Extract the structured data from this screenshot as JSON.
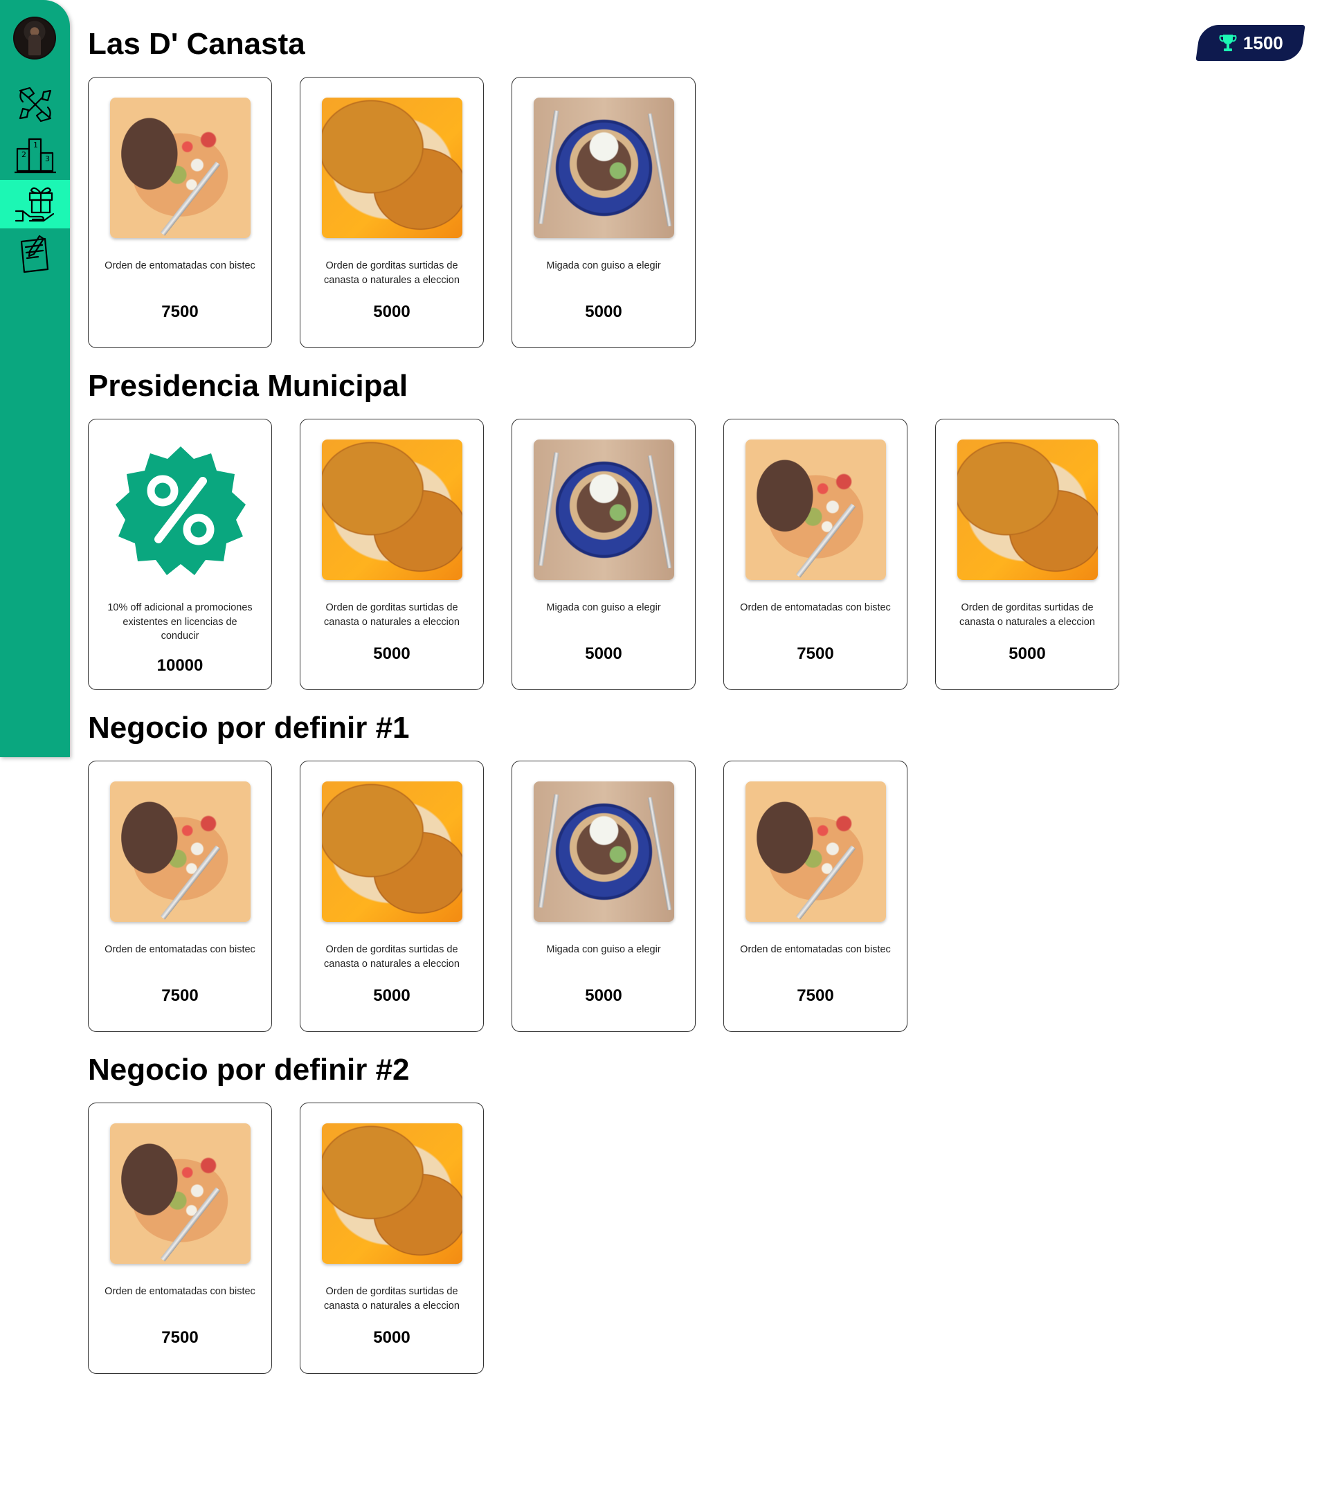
{
  "sidebar": {
    "items": [
      {
        "name": "community",
        "icon": "hands-group-icon",
        "active": false
      },
      {
        "name": "ranking",
        "icon": "podium-icon",
        "active": false
      },
      {
        "name": "rewards",
        "icon": "gift-hand-icon",
        "active": true
      },
      {
        "name": "tasks",
        "icon": "notepad-pencil-icon",
        "active": false
      }
    ]
  },
  "header": {
    "points": "1500",
    "points_icon": "trophy-icon"
  },
  "colors": {
    "sidebar": "#0aa77f",
    "sidebar_active": "#1cf7b4",
    "points_badge": "#0e1a4e",
    "trophy": "#1cf7b4"
  },
  "sections": [
    {
      "title": "Las D' Canasta",
      "items": [
        {
          "image": "entomatadas",
          "desc": "Orden de entomatadas con bistec",
          "price": "7500"
        },
        {
          "image": "gorditas",
          "desc": "Orden de gorditas surtidas de canasta o naturales a eleccion",
          "price": "5000"
        },
        {
          "image": "migada",
          "desc": "Migada con guiso a elegir",
          "price": "5000"
        }
      ]
    },
    {
      "title": "Presidencia Municipal",
      "items": [
        {
          "image": "discount-badge",
          "desc": "10% off adicional a promociones existentes en licencias de conducir",
          "price": "10000"
        },
        {
          "image": "gorditas",
          "desc": "Orden de gorditas surtidas de canasta o naturales a eleccion",
          "price": "5000"
        },
        {
          "image": "migada",
          "desc": "Migada con guiso a elegir",
          "price": "5000"
        },
        {
          "image": "entomatadas",
          "desc": "Orden de entomatadas con bistec",
          "price": "7500"
        },
        {
          "image": "gorditas",
          "desc": "Orden de gorditas surtidas de canasta o naturales a eleccion",
          "price": "5000"
        }
      ]
    },
    {
      "title": "Negocio por definir #1",
      "items": [
        {
          "image": "entomatadas",
          "desc": "Orden de entomatadas con bistec",
          "price": "7500"
        },
        {
          "image": "gorditas",
          "desc": "Orden de gorditas surtidas de canasta o naturales a eleccion",
          "price": "5000"
        },
        {
          "image": "migada",
          "desc": "Migada con guiso a elegir",
          "price": "5000"
        },
        {
          "image": "entomatadas",
          "desc": "Orden de entomatadas con bistec",
          "price": "7500"
        }
      ]
    },
    {
      "title": "Negocio por definir #2",
      "items": [
        {
          "image": "entomatadas",
          "desc": "Orden de entomatadas con bistec",
          "price": "7500"
        },
        {
          "image": "gorditas",
          "desc": "Orden de gorditas surtidas de canasta o naturales a eleccion",
          "price": "5000"
        }
      ]
    }
  ]
}
